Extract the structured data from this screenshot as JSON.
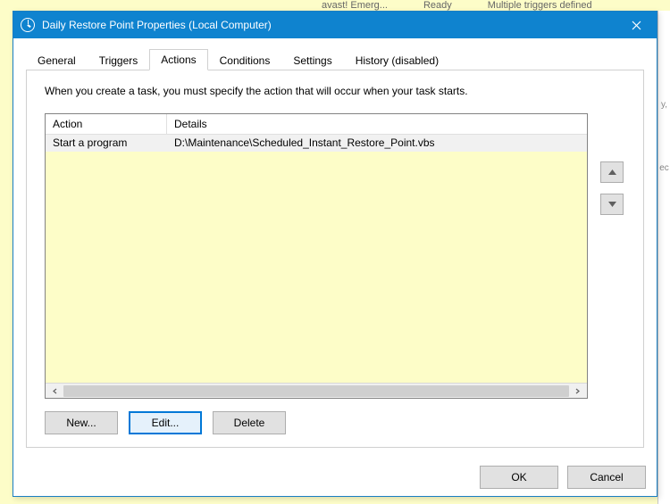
{
  "background": {
    "row": {
      "c1": "avast! Emerg...",
      "c2": "Ready",
      "c3": "Multiple triggers defined"
    },
    "side": {
      "a": "y,",
      "b": "ec"
    }
  },
  "window": {
    "title": "Daily Restore Point Properties (Local Computer)"
  },
  "tabs": [
    {
      "label": "General"
    },
    {
      "label": "Triggers"
    },
    {
      "label": "Actions",
      "active": true
    },
    {
      "label": "Conditions"
    },
    {
      "label": "Settings"
    },
    {
      "label": "History (disabled)"
    }
  ],
  "actions_tab": {
    "description": "When you create a task, you must specify the action that will occur when your task starts.",
    "headers": {
      "action": "Action",
      "details": "Details"
    },
    "rows": [
      {
        "action": "Start a program",
        "details": "D:\\Maintenance\\Scheduled_Instant_Restore_Point.vbs",
        "selected": true
      }
    ],
    "buttons": {
      "new": "New...",
      "edit": "Edit...",
      "delete": "Delete"
    }
  },
  "footer": {
    "ok": "OK",
    "cancel": "Cancel"
  }
}
